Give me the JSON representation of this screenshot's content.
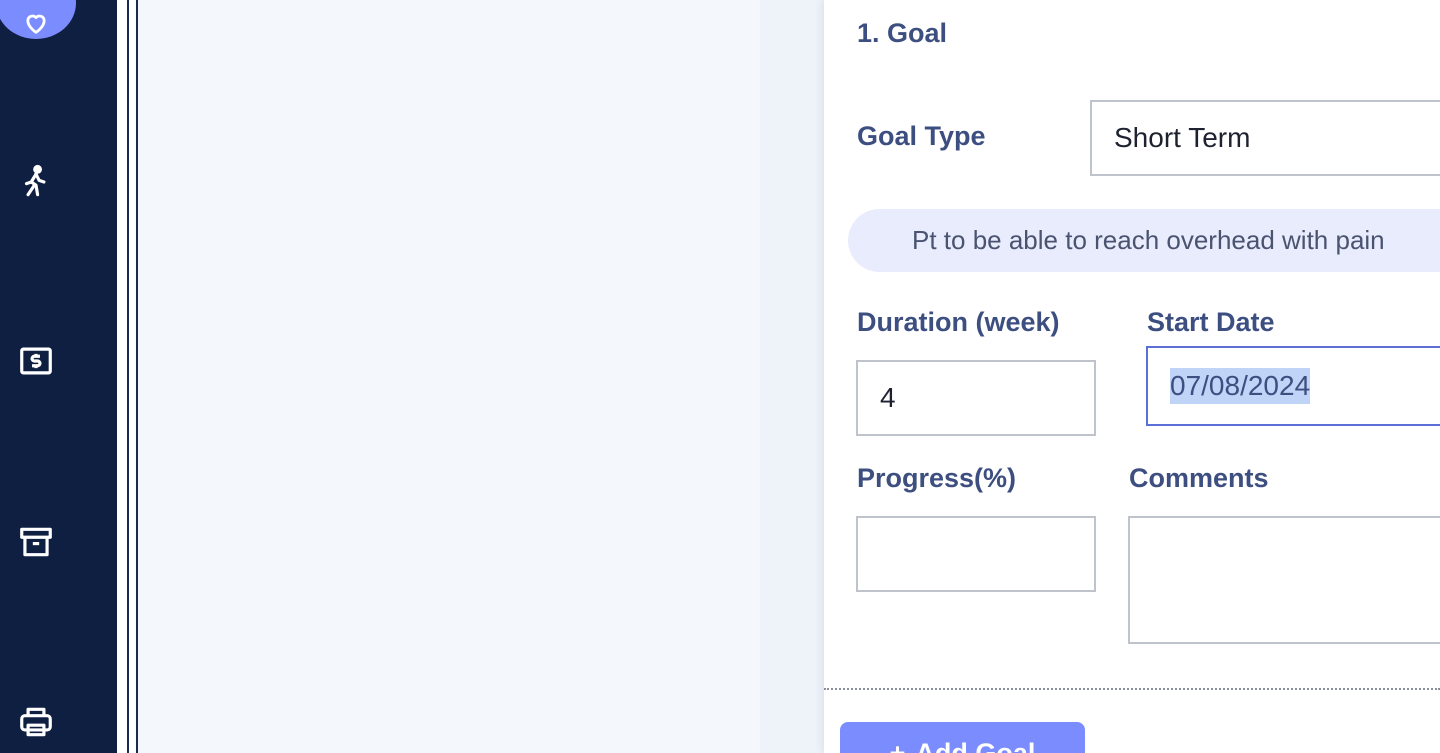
{
  "sidebar": {
    "items": [
      {
        "icon": "heart-icon",
        "active": true
      },
      {
        "icon": "walking-person-icon"
      },
      {
        "icon": "dollar-bill-icon"
      },
      {
        "icon": "archive-box-icon"
      },
      {
        "icon": "printer-icon"
      }
    ]
  },
  "goal": {
    "heading": "1. Goal",
    "goal_type_label": "Goal Type",
    "goal_type_value": "Short Term",
    "description": "Pt to be able to reach overhead with pain",
    "duration_label": "Duration (week)",
    "duration_value": "4",
    "start_date_label": "Start Date",
    "start_date_value": "07/08/2024",
    "progress_label": "Progress(%)",
    "progress_value": "",
    "comments_label": "Comments",
    "comments_value": "",
    "add_goal_label": "Add Goal",
    "add_goal_icon": "plus-icon"
  },
  "colors": {
    "sidebar_bg": "#0f1f42",
    "accent": "#7b8cff",
    "label_text": "#3d4f80",
    "canvas_bg": "#f4f7fc",
    "description_bg": "#e9ecfd"
  }
}
